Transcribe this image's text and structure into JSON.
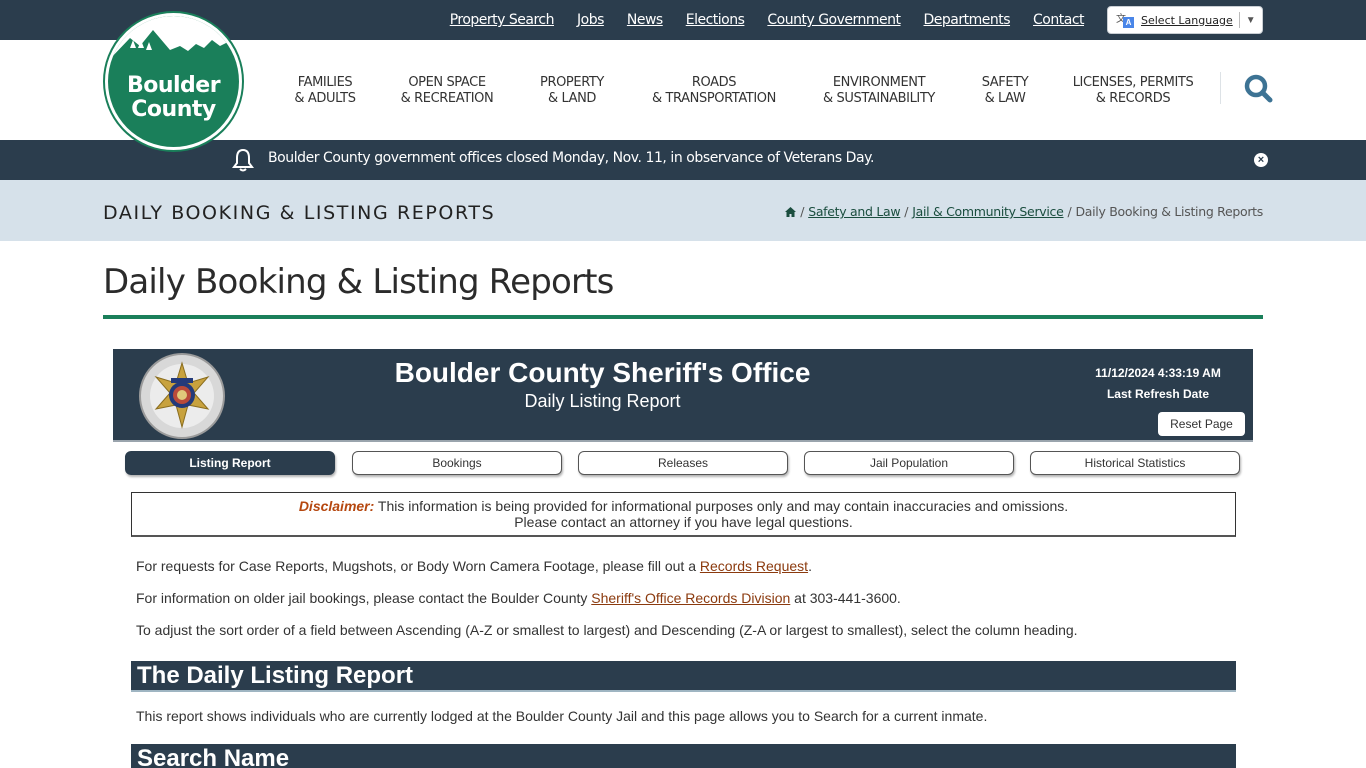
{
  "utility_nav": {
    "links": [
      "Property Search",
      "Jobs",
      "News",
      "Elections",
      "County Government",
      "Departments",
      "Contact"
    ],
    "translate_label": "Select Language"
  },
  "logo": {
    "line1": "Boulder",
    "line2": "County"
  },
  "main_nav": [
    {
      "line1": "Families",
      "line2": "& Adults"
    },
    {
      "line1": "Open Space",
      "line2": "& Recreation"
    },
    {
      "line1": "Property",
      "line2": "& Land"
    },
    {
      "line1": "Roads",
      "line2": "& Transportation"
    },
    {
      "line1": "Environment",
      "line2": "& Sustainability"
    },
    {
      "line1": "Safety",
      "line2": "& Law"
    },
    {
      "line1": "Licenses, Permits",
      "line2": "& Records"
    }
  ],
  "alert": {
    "text": "Boulder County government offices closed Monday, Nov. 11, in observance of Veterans Day.",
    "close_glyph": "×"
  },
  "section_banner": {
    "title": "Daily Booking & Listing Reports",
    "breadcrumb": {
      "items": [
        "Safety and Law",
        "Jail & Community Service"
      ],
      "current": "Daily Booking & Listing Reports",
      "separator": "/"
    }
  },
  "page": {
    "title": "Daily Booking & Listing Reports"
  },
  "report": {
    "org_title": "Boulder County Sheriff's Office",
    "subtitle": "Daily Listing Report",
    "refresh_date": "11/12/2024 4:33:19 AM",
    "refresh_label": "Last Refresh Date",
    "reset_label": "Reset Page",
    "tabs": [
      {
        "label": "Listing Report",
        "active": true
      },
      {
        "label": "Bookings",
        "active": false
      },
      {
        "label": "Releases",
        "active": false
      },
      {
        "label": "Jail Population",
        "active": false
      },
      {
        "label": "Historical Statistics",
        "active": false
      }
    ],
    "disclaimer": {
      "label": "Disclaimer:",
      "line1": " This information is being provided for informational purposes only and may contain inaccuracies and omissions.",
      "line2": "Please contact an attorney if you have legal questions."
    },
    "para1": {
      "before": "For requests for Case Reports, Mugshots, or Body Worn Camera Footage, please fill out a ",
      "link": "Records Request",
      "after": "."
    },
    "para2": {
      "before": "For information on older jail bookings, please contact the Boulder County ",
      "link": "Sheriff's Office Records Division",
      "after": " at 303-441-3600."
    },
    "para3": "To adjust the sort order of a field between Ascending (A-Z or smallest to largest) and Descending (Z-A or largest to smallest), select the column heading.",
    "section1_title": "The Daily Listing Report",
    "section1_text": "This report shows individuals who are currently lodged at the Boulder County Jail and this page allows you to Search for a current inmate.",
    "section2_title": "Search Name"
  },
  "colors": {
    "navy": "#2b3d4d",
    "green": "#1a7f5a",
    "banner": "#d6e1ea",
    "link_brown": "#8b3a0e",
    "disclaimer": "#b5470f",
    "search_icon": "#3d7394"
  }
}
